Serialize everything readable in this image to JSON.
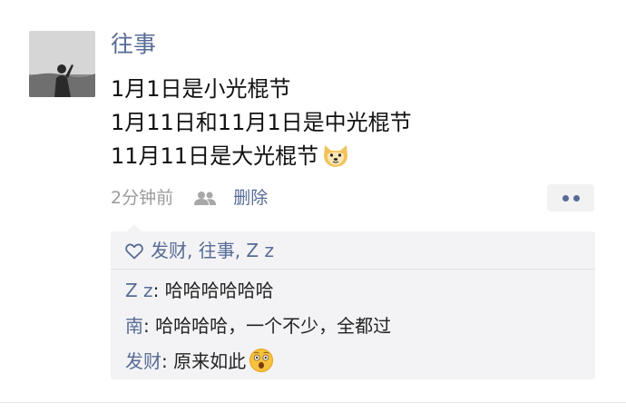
{
  "moment": {
    "author": "往事",
    "lines": [
      "1月1日是小光棍节",
      "1月11日和11月1日是中光棍节",
      "11月11日是大光棍节"
    ],
    "line_emoji": "doge-emoji",
    "time": "2分钟前",
    "visibility_icon": "users-icon",
    "delete_label": "删除",
    "more_icon": "more-dots-icon"
  },
  "likes": {
    "icon": "heart-icon",
    "names": "发财, 往事, Z z"
  },
  "comments": [
    {
      "author": "Z z",
      "text": ": 哈哈哈哈哈哈",
      "emoji": null
    },
    {
      "author": "南",
      "text": ": 哈哈哈哈，一个不少，全都过",
      "emoji": null
    },
    {
      "author": "发财",
      "text": ": 原来如此",
      "emoji": "astonished-face-emoji"
    }
  ],
  "colors": {
    "link": "#576b95",
    "meta_gray": "#9b9b9b",
    "comment_bg": "#f3f3f5"
  }
}
